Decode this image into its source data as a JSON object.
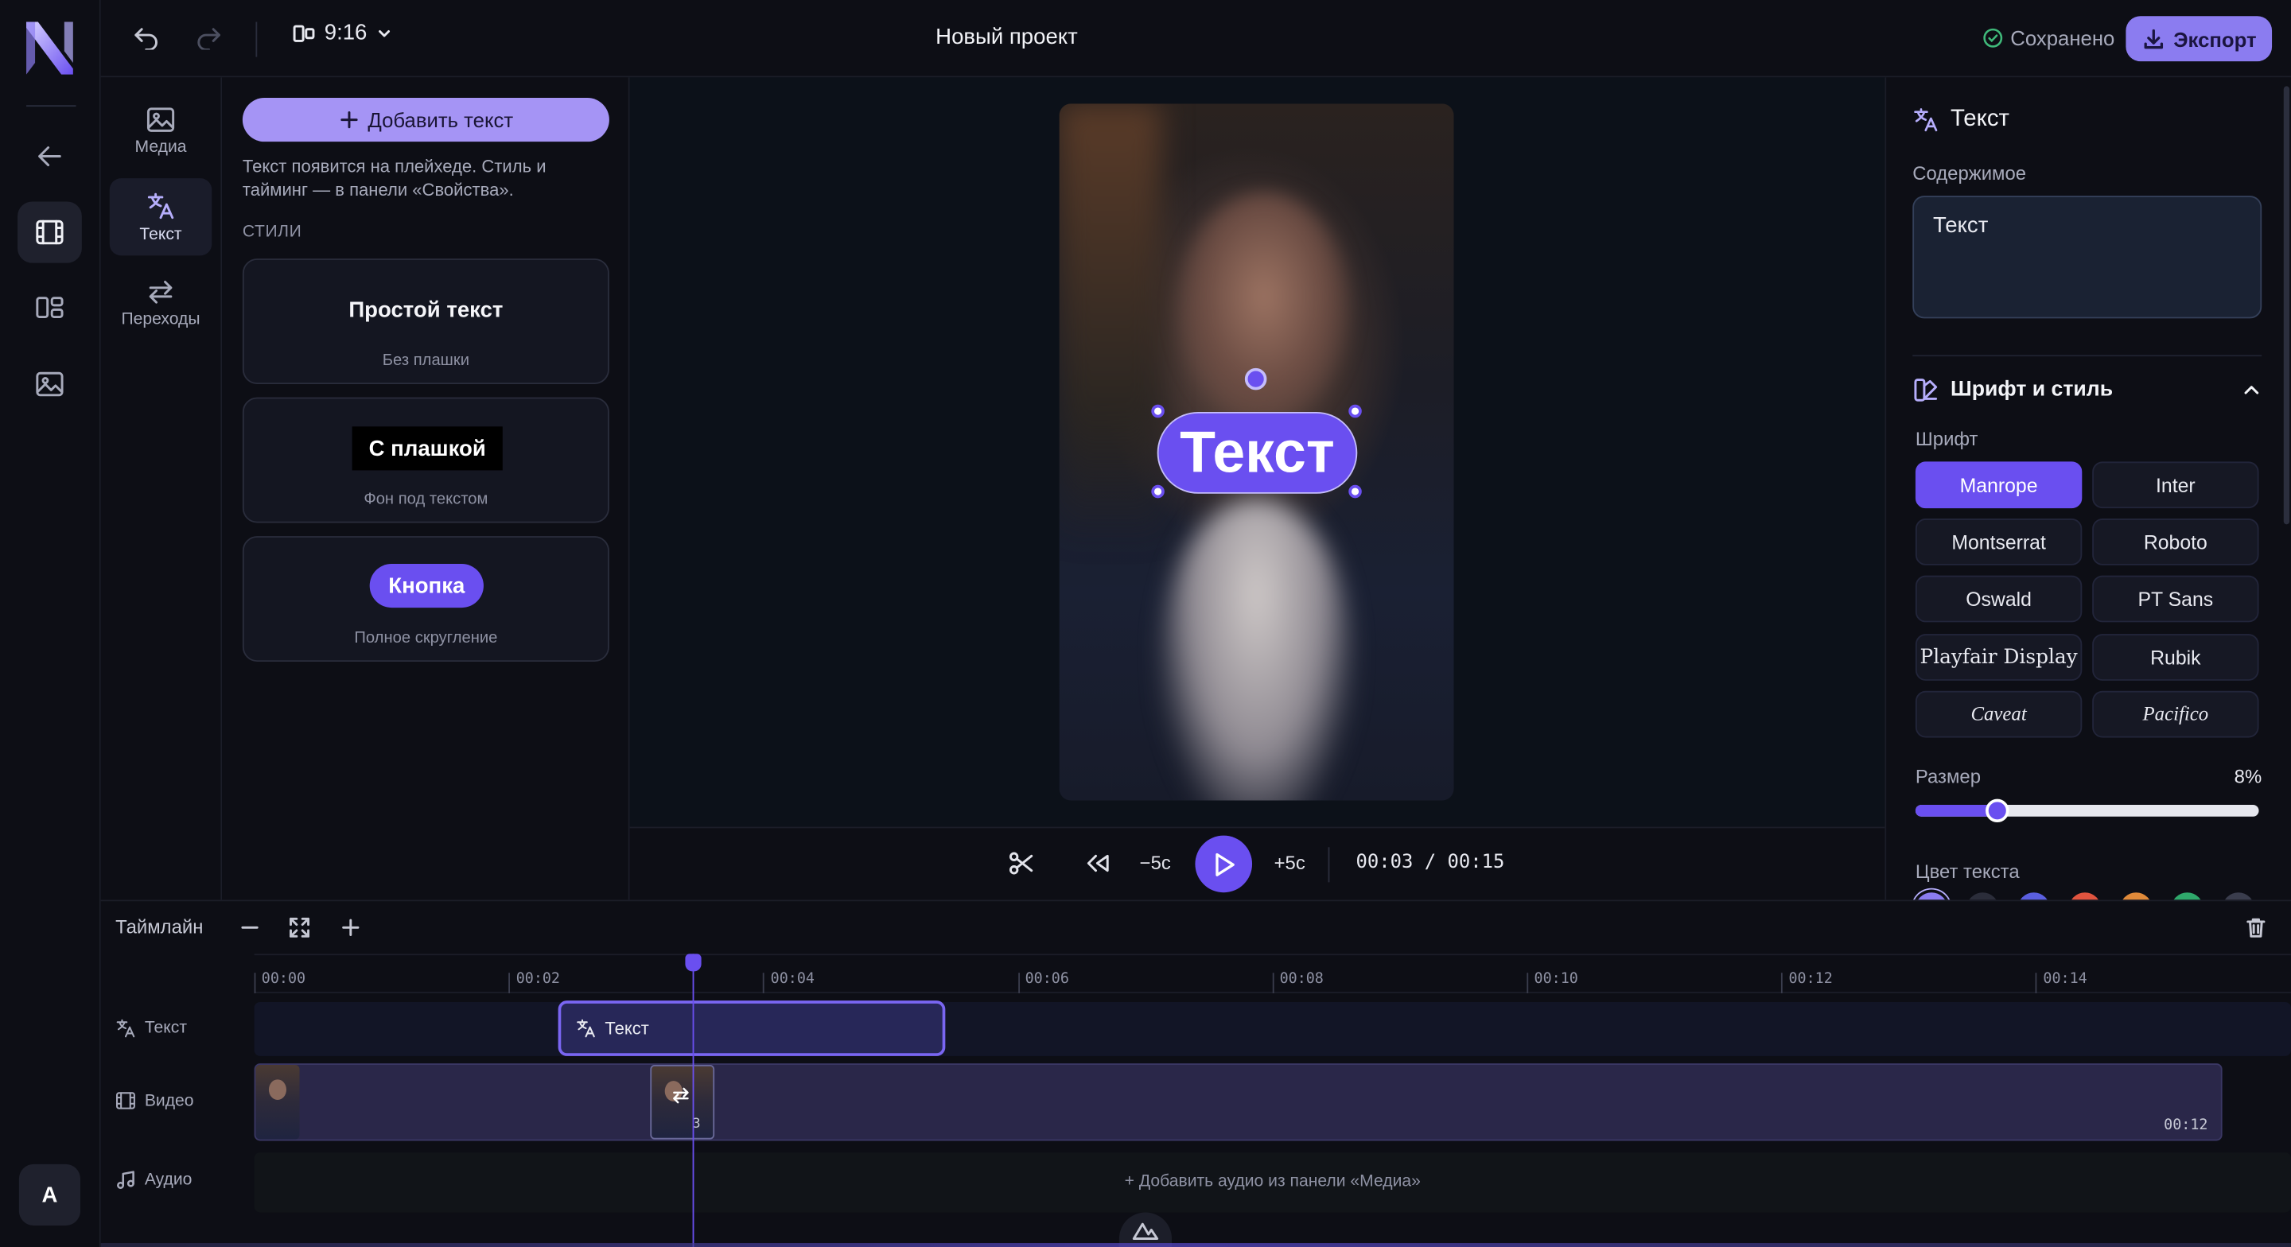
{
  "app": {
    "title": "Новый проект",
    "accent": "#6a4ff0",
    "accent_light": "#a594f5"
  },
  "topbar": {
    "aspect_ratio": "9:16",
    "status": "Сохранено",
    "export_label": "Экспорт"
  },
  "rail": {
    "avatar_letter": "A"
  },
  "tools": [
    {
      "label": "Медиа",
      "icon": "image-icon"
    },
    {
      "label": "Текст",
      "icon": "translate-text-icon",
      "active": true
    },
    {
      "label": "Переходы",
      "icon": "swap-arrows-icon"
    }
  ],
  "text_panel": {
    "add_button": "Добавить текст",
    "hint": "Текст появится на плейхеде. Стиль и тайминг — в панели «Свойства».",
    "styles_label": "СТИЛИ",
    "styles": [
      {
        "title": "Простой текст",
        "subtitle": "Без плашки"
      },
      {
        "title": "С плашкой",
        "subtitle": "Фон под текстом"
      },
      {
        "title": "Кнопка",
        "subtitle": "Полное скругление"
      }
    ]
  },
  "preview": {
    "overlay_text": "Текст"
  },
  "transport": {
    "back_label": "−5с",
    "forward_label": "+5с",
    "current_time": "00:03",
    "separator": "/",
    "total_time": "00:15"
  },
  "properties": {
    "title": "Текст",
    "content_label": "Содержимое",
    "content_value": "Текст",
    "font_section": "Шрифт и стиль",
    "font_label": "Шрифт",
    "fonts": [
      "Manrope",
      "Inter",
      "Montserrat",
      "Roboto",
      "Oswald",
      "PT Sans",
      "Playfair Display",
      "Rubik",
      "Caveat",
      "Pacifico"
    ],
    "selected_font": "Manrope",
    "size_label": "Размер",
    "size_value": "8%",
    "size_percent": 8,
    "color_label": "Цвет текста",
    "colors": [
      "#8b7cf0",
      "#2b2d3a",
      "#5b5fe0",
      "#e0543f",
      "#e08a3a",
      "#2fa86b",
      "#3a3d4d"
    ]
  },
  "timeline": {
    "title": "Таймлайн",
    "ticks": [
      "00:00",
      "00:02",
      "00:04",
      "00:06",
      "00:08",
      "00:10",
      "00:12",
      "00:14"
    ],
    "playhead_time_s": 3,
    "tracks": [
      {
        "label": "Текст",
        "icon": "translate-text-icon"
      },
      {
        "label": "Видео",
        "icon": "film-icon"
      },
      {
        "label": "Аудио",
        "icon": "music-note-icon"
      }
    ],
    "text_clip_label": "Текст",
    "video_clip_end": "00:12",
    "video_clip_badge": "3",
    "audio_hint": "+ Добавить аудио из панели «Медиа»"
  }
}
